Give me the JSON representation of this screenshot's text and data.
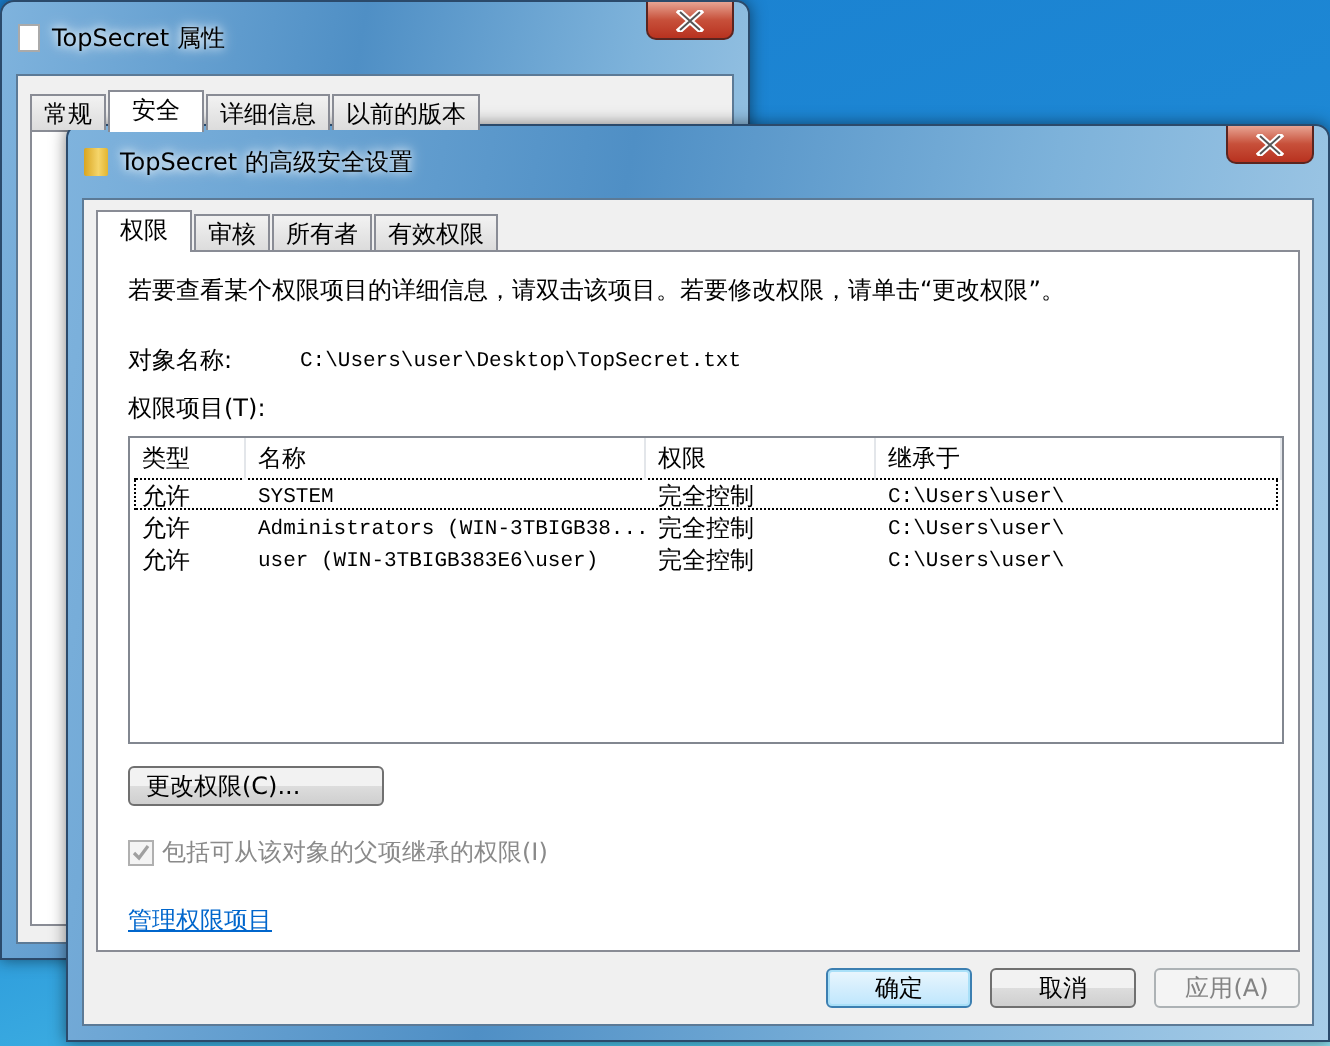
{
  "properties_window": {
    "title": "TopSecret 属性",
    "tabs": [
      {
        "label": "常规",
        "selected": false
      },
      {
        "label": "安全",
        "selected": true
      },
      {
        "label": "详细信息",
        "selected": false
      },
      {
        "label": "以前的版本",
        "selected": false
      }
    ]
  },
  "advanced_window": {
    "title": "TopSecret 的高级安全设置",
    "tabs": [
      {
        "label": "权限",
        "selected": true
      },
      {
        "label": "审核",
        "selected": false
      },
      {
        "label": "所有者",
        "selected": false
      },
      {
        "label": "有效权限",
        "selected": false
      }
    ],
    "description": "若要查看某个权限项目的详细信息，请双击该项目。若要修改权限，请单击“更改权限”。",
    "object_name_label": "对象名称:",
    "object_name": "C:\\Users\\user\\Desktop\\TopSecret.txt",
    "entries_label": "权限项目(T):",
    "table": {
      "columns": [
        "类型",
        "名称",
        "权限",
        "继承于"
      ],
      "rows": [
        {
          "cells": [
            "允许",
            "SYSTEM",
            "完全控制",
            "C:\\Users\\user\\"
          ],
          "focused": true
        },
        {
          "cells": [
            "允许",
            "Administrators (WIN-3TBIGB38...",
            "完全控制",
            "C:\\Users\\user\\"
          ],
          "focused": false
        },
        {
          "cells": [
            "允许",
            "user (WIN-3TBIGB383E6\\user)",
            "完全控制",
            "C:\\Users\\user\\"
          ],
          "focused": false
        }
      ]
    },
    "change_button": "更改权限(C)...",
    "inherit_checkbox": {
      "label": "包括可从该对象的父项继承的权限(I)",
      "checked": true,
      "disabled": true
    },
    "manage_link": "管理权限项目",
    "buttons": [
      {
        "label": "确定",
        "kind": "default"
      },
      {
        "label": "取消",
        "kind": "normal"
      },
      {
        "label": "应用(A)",
        "kind": "disabled"
      }
    ]
  }
}
